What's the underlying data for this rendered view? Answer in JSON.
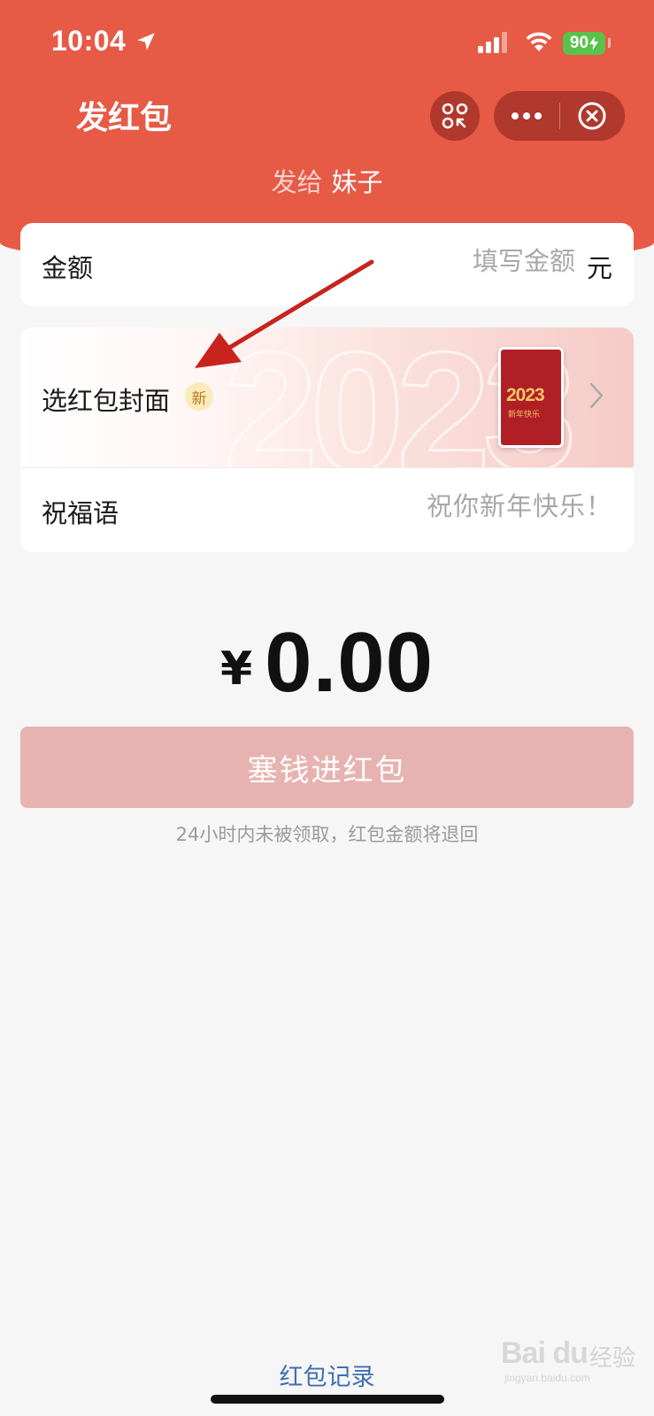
{
  "status_bar": {
    "time": "10:04",
    "battery_level": "90",
    "icons": [
      "location-arrow-icon",
      "signal-icon",
      "wifi-icon",
      "battery-charging-icon"
    ]
  },
  "header": {
    "title": "发红包",
    "recipient_prefix": "发给",
    "recipient_name": "妹子",
    "icons": [
      "scan-icon",
      "more-icon",
      "close-icon"
    ],
    "color": "#e65a46"
  },
  "amount": {
    "label": "金额",
    "placeholder": "填写金额",
    "unit": "元"
  },
  "cover": {
    "label": "选红包封面",
    "badge": "新",
    "background_year": "2023",
    "thumbnail_year": "2023",
    "thumbnail_text": "新年快乐"
  },
  "wish": {
    "label": "祝福语",
    "placeholder": "祝你新年快乐！"
  },
  "total": {
    "currency": "¥",
    "value": "0.00"
  },
  "submit": {
    "label": "塞钱进红包",
    "color": "#e7b3b0"
  },
  "notice": "24小时内未被领取，红包金额将退回",
  "footer": {
    "records_label": "红包记录"
  },
  "watermark": {
    "logo": "Bai du",
    "chinese": "经验",
    "url": "jingyan.baidu.com"
  }
}
